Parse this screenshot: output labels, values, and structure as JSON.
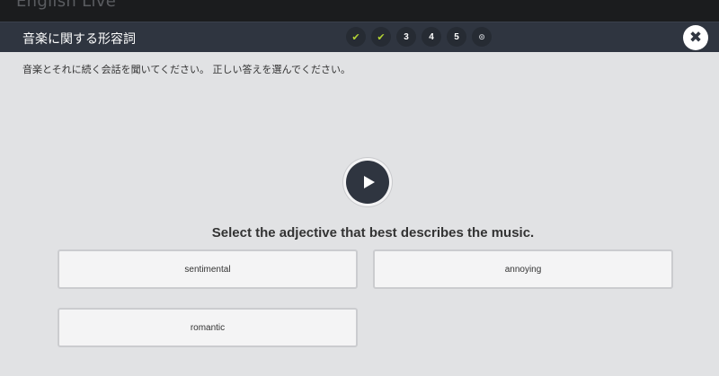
{
  "app": {
    "brand": "English Live"
  },
  "header": {
    "title": "音楽に関する形容詞",
    "steps": [
      {
        "label": "✔",
        "state": "done"
      },
      {
        "label": "✔",
        "state": "done"
      },
      {
        "label": "3",
        "state": "current"
      },
      {
        "label": "4",
        "state": "pending"
      },
      {
        "label": "5",
        "state": "pending"
      },
      {
        "label": "⊙",
        "state": "end"
      }
    ],
    "close_label": "✖"
  },
  "instruction": "音楽とそれに続く会話を聞いてください。 正しい答えを選んでください。",
  "question": "Select the adjective that best describes the music.",
  "choices": [
    "sentimental",
    "annoying",
    "romantic"
  ],
  "colors": {
    "header_bg": "#2f3540",
    "page_bg": "#e1e2e4",
    "done_check": "#b3d334"
  }
}
